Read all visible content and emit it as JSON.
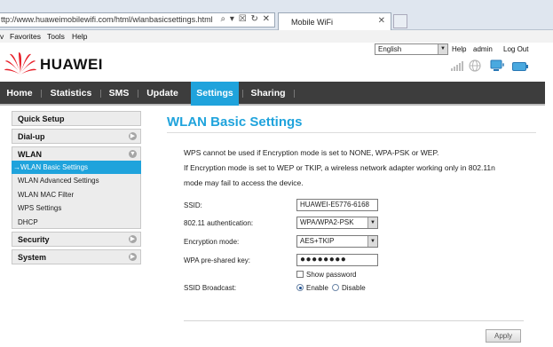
{
  "browser": {
    "url": "ttp://www.huaweimobilewifi.com/html/wlanbasicsettings.html",
    "address_icons": "⌕ ▾ ☒ ↻ ✕",
    "tab_title": "Mobile WiFi",
    "tab_close": "✕",
    "menu": [
      "v",
      "Favorites",
      "Tools",
      "Help"
    ]
  },
  "header": {
    "brand": "HUAWEI",
    "language": "English",
    "help_label": "Help",
    "user_label": "admin",
    "logout_label": "Log Out",
    "brand_color": "#e8202a"
  },
  "nav": {
    "items": [
      "Home",
      "Statistics",
      "SMS",
      "Update",
      "Settings",
      "Sharing"
    ],
    "active": "Settings",
    "accent": "#1fa3dc"
  },
  "sidebar": {
    "quick_setup": "Quick Setup",
    "dialup": "Dial-up",
    "wlan": "WLAN",
    "wlan_items": [
      "→WLAN Basic Settings",
      "WLAN Advanced Settings",
      "WLAN MAC Filter",
      "WPS Settings",
      "DHCP"
    ],
    "security": "Security",
    "system": "System",
    "toggle_collapsed": "▶",
    "toggle_expanded": "▼"
  },
  "main": {
    "title": "WLAN Basic Settings",
    "info_lines": [
      "WPS cannot be used if Encryption mode is set to NONE, WPA-PSK or WEP.",
      "If Encryption mode is set to WEP or TKIP, a wireless network adapter working only in 802.11n",
      "mode may fail to access the device."
    ],
    "ssid_label": "SSID:",
    "ssid_value": "HUAWEI-E5776-6168",
    "auth_label": "802.11 authentication:",
    "auth_value": "WPA/WPA2-PSK",
    "enc_label": "Encryption mode:",
    "enc_value": "AES+TKIP",
    "key_label": "WPA pre-shared key:",
    "key_value": "●●●●●●●●",
    "show_password": "Show password",
    "broadcast_label": "SSID Broadcast:",
    "enable_label": "Enable",
    "disable_label": "Disable",
    "broadcast_selected": "Enable",
    "apply_label": "Apply"
  }
}
